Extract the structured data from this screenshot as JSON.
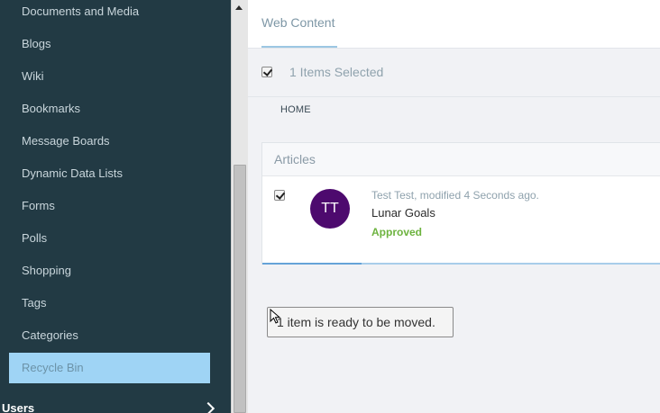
{
  "sidebar": {
    "items": [
      {
        "label": "Documents and Media"
      },
      {
        "label": "Blogs"
      },
      {
        "label": "Wiki"
      },
      {
        "label": "Bookmarks"
      },
      {
        "label": "Message Boards"
      },
      {
        "label": "Dynamic Data Lists"
      },
      {
        "label": "Forms"
      },
      {
        "label": "Polls"
      },
      {
        "label": "Shopping"
      },
      {
        "label": "Tags"
      },
      {
        "label": "Categories"
      },
      {
        "label": "Recycle Bin"
      }
    ],
    "section": {
      "label": "Users"
    }
  },
  "main": {
    "tab": {
      "label": "Web Content"
    },
    "selection": {
      "label": "1 Items Selected"
    },
    "breadcrumb": {
      "label": "HOME"
    },
    "articles": {
      "title": "Articles",
      "row": {
        "avatar_initials": "TT",
        "avatar_color": "#4d0a6e",
        "meta": "Test Test, modified 4 Seconds ago.",
        "title": "Lunar Goals",
        "status": "Approved",
        "status_color": "#6db33f"
      }
    },
    "drag_message": "1 item is ready to be moved."
  },
  "icons": {
    "users_chevron": "chevron-right-icon",
    "cursor": "cursor-arrow-icon"
  }
}
